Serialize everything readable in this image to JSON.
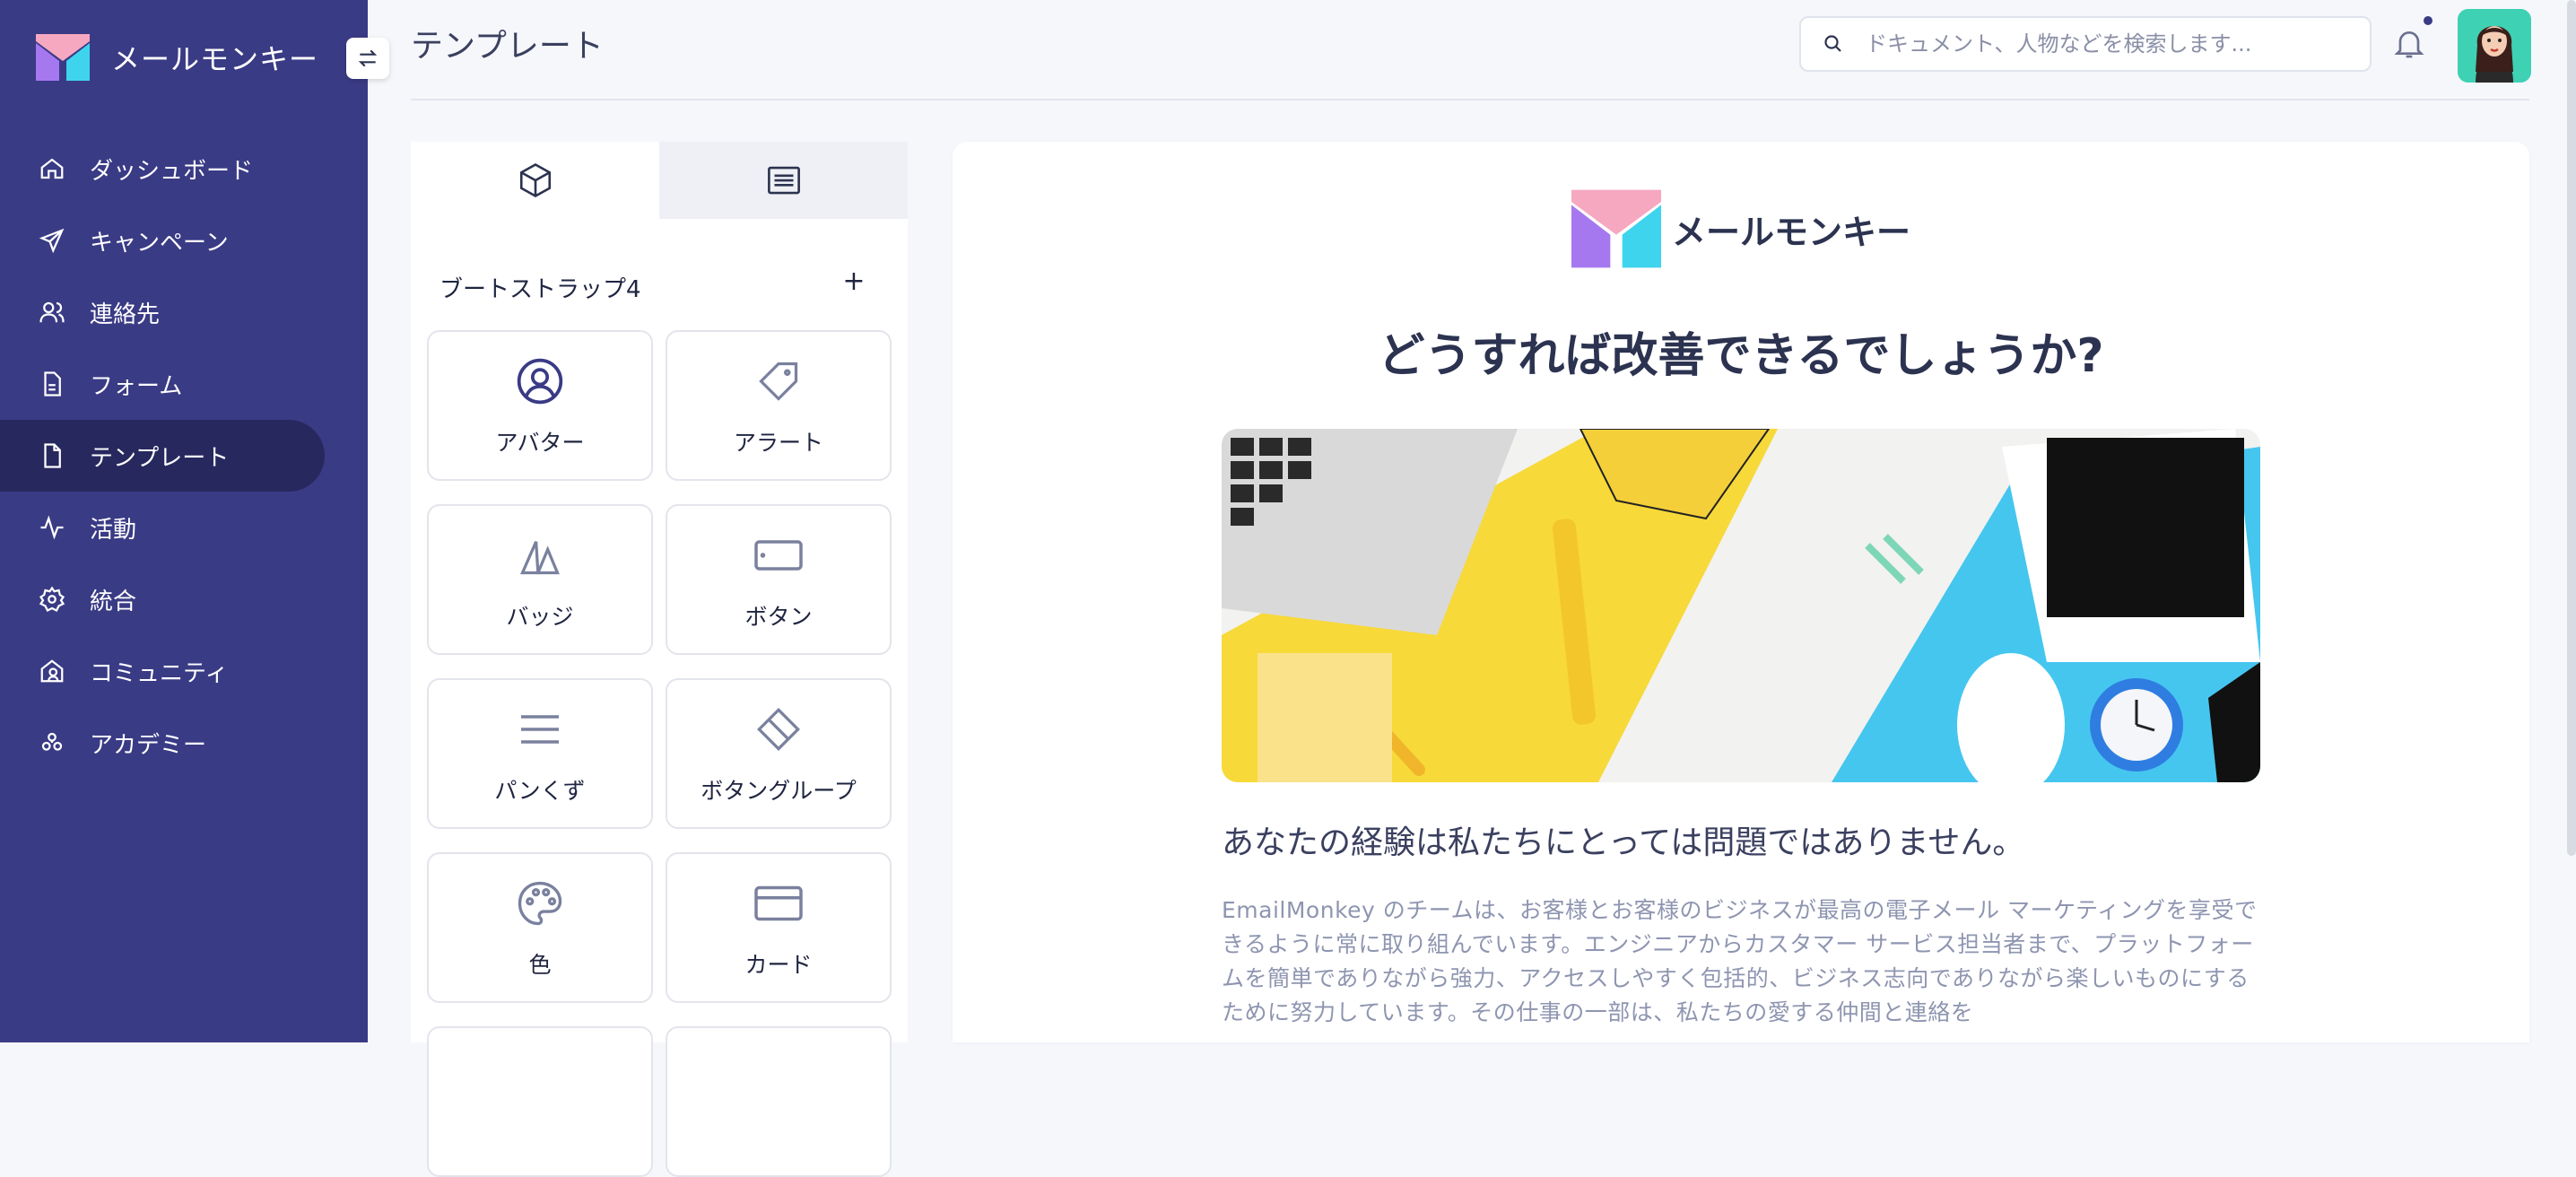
{
  "brand": {
    "name": "メールモンキー"
  },
  "sidebar": {
    "items": [
      {
        "label": "ダッシュボード",
        "icon": "home-icon"
      },
      {
        "label": "キャンペーン",
        "icon": "send-icon"
      },
      {
        "label": "連絡先",
        "icon": "users-icon"
      },
      {
        "label": "フォーム",
        "icon": "form-icon"
      },
      {
        "label": "テンプレート",
        "icon": "file-icon",
        "active": true
      },
      {
        "label": "活動",
        "icon": "activity-icon"
      },
      {
        "label": "統合",
        "icon": "gear-icon"
      },
      {
        "label": "コミュニティ",
        "icon": "community-icon"
      },
      {
        "label": "アカデミー",
        "icon": "academy-icon"
      }
    ]
  },
  "header": {
    "title": "テンプレート",
    "search_placeholder": "ドキュメント、人物などを検索します..."
  },
  "components": {
    "tabs": [
      "cube-icon",
      "list-icon"
    ],
    "group_title": "ブートストラップ4",
    "add_label": "+",
    "tiles": [
      {
        "label": "アバター",
        "icon": "user-circle-icon"
      },
      {
        "label": "アラート",
        "icon": "tag-icon"
      },
      {
        "label": "バッジ",
        "icon": "badge-icon"
      },
      {
        "label": "ボタン",
        "icon": "button-icon"
      },
      {
        "label": "パンくず",
        "icon": "menu-lines-icon"
      },
      {
        "label": "ボタングループ",
        "icon": "eraser-icon"
      },
      {
        "label": "色",
        "icon": "palette-icon"
      },
      {
        "label": "カード",
        "icon": "credit-card-icon"
      }
    ]
  },
  "email": {
    "brand": "メールモンキー",
    "headline": "どうすれば改善できるでしょうか?",
    "subheading": "あなたの経験は私たちにとっては問題ではありません。",
    "body": "EmailMonkey のチームは、お客様とお客様のビジネスが最高の電子メール マーケティングを享受できるように常に取り組んでいます。エンジニアからカスタマー サービス担当者まで、プラットフォームを簡単でありながら強力、アクセスしやすく包括的、ビジネス志向でありながら楽しいものにするために努力しています。その仕事の一部は、私たちの愛する仲間と連絡を"
  },
  "colors": {
    "sidebar_bg": "#3a3b85",
    "sidebar_active": "#27285e",
    "logo_pink": "#f6a8c0",
    "logo_purple": "#a678f0",
    "logo_cyan": "#3fd4ee"
  }
}
